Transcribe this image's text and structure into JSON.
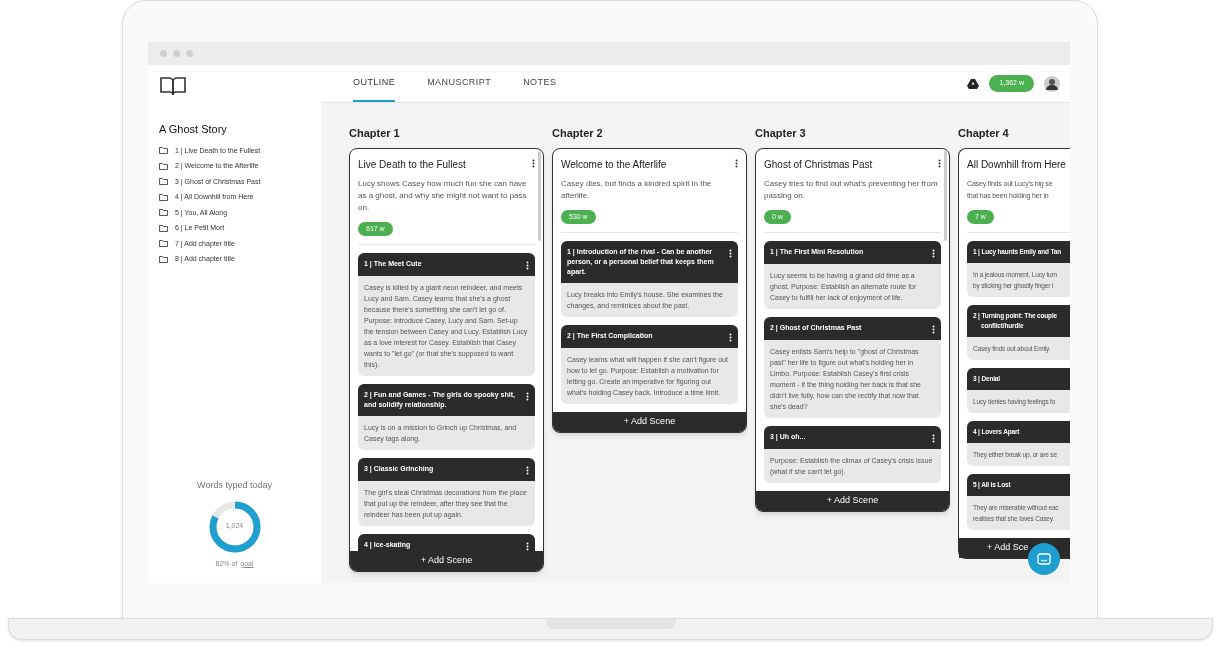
{
  "sidebar": {
    "project_title": "A Ghost Story",
    "chapters": [
      "1 | Live Death to the Fullest",
      "2 | Welcome to the Afterlife",
      "3 | Ghost of Christmas Past",
      "4 | All Downhill from Here",
      "5 | You, All Along",
      "6 | Le Petit Mort",
      "7 | Add chapter title",
      "8 | Add chapter title"
    ],
    "words_today": {
      "label": "Words typed today",
      "count": "1,024",
      "level": 0.82,
      "goal_text": "82% of",
      "goal_link": "goal"
    }
  },
  "tabs": [
    {
      "label": "OUTLINE",
      "selected": true
    },
    {
      "label": "MANUSCRIPT",
      "selected": false
    },
    {
      "label": "NOTES",
      "selected": false
    }
  ],
  "total_words": "1,362 w",
  "chapters": [
    {
      "heading": "Chapter 1",
      "title": "Live Death to the Fullest",
      "description": "Lucy shows Casey how much fun she can have as a ghost, and why she might not want to pass on.",
      "words": "617 w",
      "scrollable": true,
      "add_label": "+ Add Scene",
      "scenes": [
        {
          "title": "1 | The Meet Cute",
          "body": "Casey is killed by a giant neon reindeer, and meets Lucy and Sam. Casey learns that she's a ghost because there's something she can't let go of. Purpose: Introduce Casey, Lucy and Sam. Set-up the tension between Casey and Lucy. Establish Lucy as a love interest for Casey. Establish that Casey wants to \"let go\" (or that she's supposed to want this)."
        },
        {
          "title": "2 | Fun and Games - The girls do spooky shit, and solidify relationship.",
          "body": "Lucy is on a mission to Grinch up Christmas, and Casey tags along."
        },
        {
          "title": "3 | Classic Grinching",
          "body": "The girl's steal Christmas decorations from the place that put up the reindeer, after they see that the reindeer has been put up again."
        },
        {
          "title": "4 | Ice-skating"
        }
      ]
    },
    {
      "heading": "Chapter 2",
      "title": "Welcome to the Afterlife",
      "description": "Casey dies, but finds a kindred spirit in the afterlife.",
      "words": "530 w",
      "scrollable": false,
      "add_label": "+ Add Scene",
      "scenes": [
        {
          "title": "1 | Introduction of the rival - Can be another person, or a personal belief that keeps them apart.",
          "body": "Lucy breaks into Emily's house. She examines the changes, and reminices about the past."
        },
        {
          "title": "2 | The First Complication",
          "body": "Casey learns what will happen if she can't figure out how to let go. Purpose: Establish a motivation for letting go. Create an imperative for figuring out what's holding Casey back. Introduce a time limit."
        }
      ]
    },
    {
      "heading": "Chapter 3",
      "title": "Ghost of Christmas Past",
      "description": "Casey tries to find out what's preventing her from passing on.",
      "words": "0 w",
      "scrollable": true,
      "add_label": "+ Add Scene",
      "scenes": [
        {
          "title": "1 | The First Mini Resolution",
          "body": "Lucy seems to be having a grand old time as a ghost. Purpose: Establish an alternate route for Casey to fulfill her lack of enjoyment of life."
        },
        {
          "title": "2 | Ghost of Christmas Past",
          "body": "Casey enlists Sam's help to \"ghost of Christmas past\" her life to figure out what's holding her in Limbo. Purpose: Establish Casey's first crisis moment - if the thing holding her back is that she didn't live fully, how can she rectify that now that she's dead?"
        },
        {
          "title": "3 | Uh oh...",
          "body": "Purpose: Establish the climax of Casey's crisis issue (what if she can't let go)."
        }
      ]
    }
  ],
  "cut_chapter": {
    "heading": "Chapter 4",
    "title": "All Downhill from Here",
    "description": [
      "Casey finds out Lucy's big se",
      "that has been holding her in"
    ],
    "words": "7 w",
    "add_label": "+ Add Sce",
    "scenes": [
      {
        "title": [
          "1 | Lucy haunts Emily and Tan"
        ],
        "body": [
          "In a jealous moment, Lucy turn",
          "by sticking her ghostly finger i"
        ]
      },
      {
        "title": [
          "2 | Turning point: The couple",
          "conflict/hurdle"
        ],
        "body": [
          "Casey finds out about Emily."
        ]
      },
      {
        "title": [
          "3 | Denial"
        ],
        "body": [
          "Lucy denies having feelings fo"
        ]
      },
      {
        "title": [
          "4 | Lovers Apart"
        ],
        "body": [
          "They either break up, or are se"
        ]
      },
      {
        "title": [
          "5 | All is Lost"
        ],
        "body": [
          "They are miserable without eac",
          "realises that she loves Casey."
        ]
      }
    ]
  }
}
